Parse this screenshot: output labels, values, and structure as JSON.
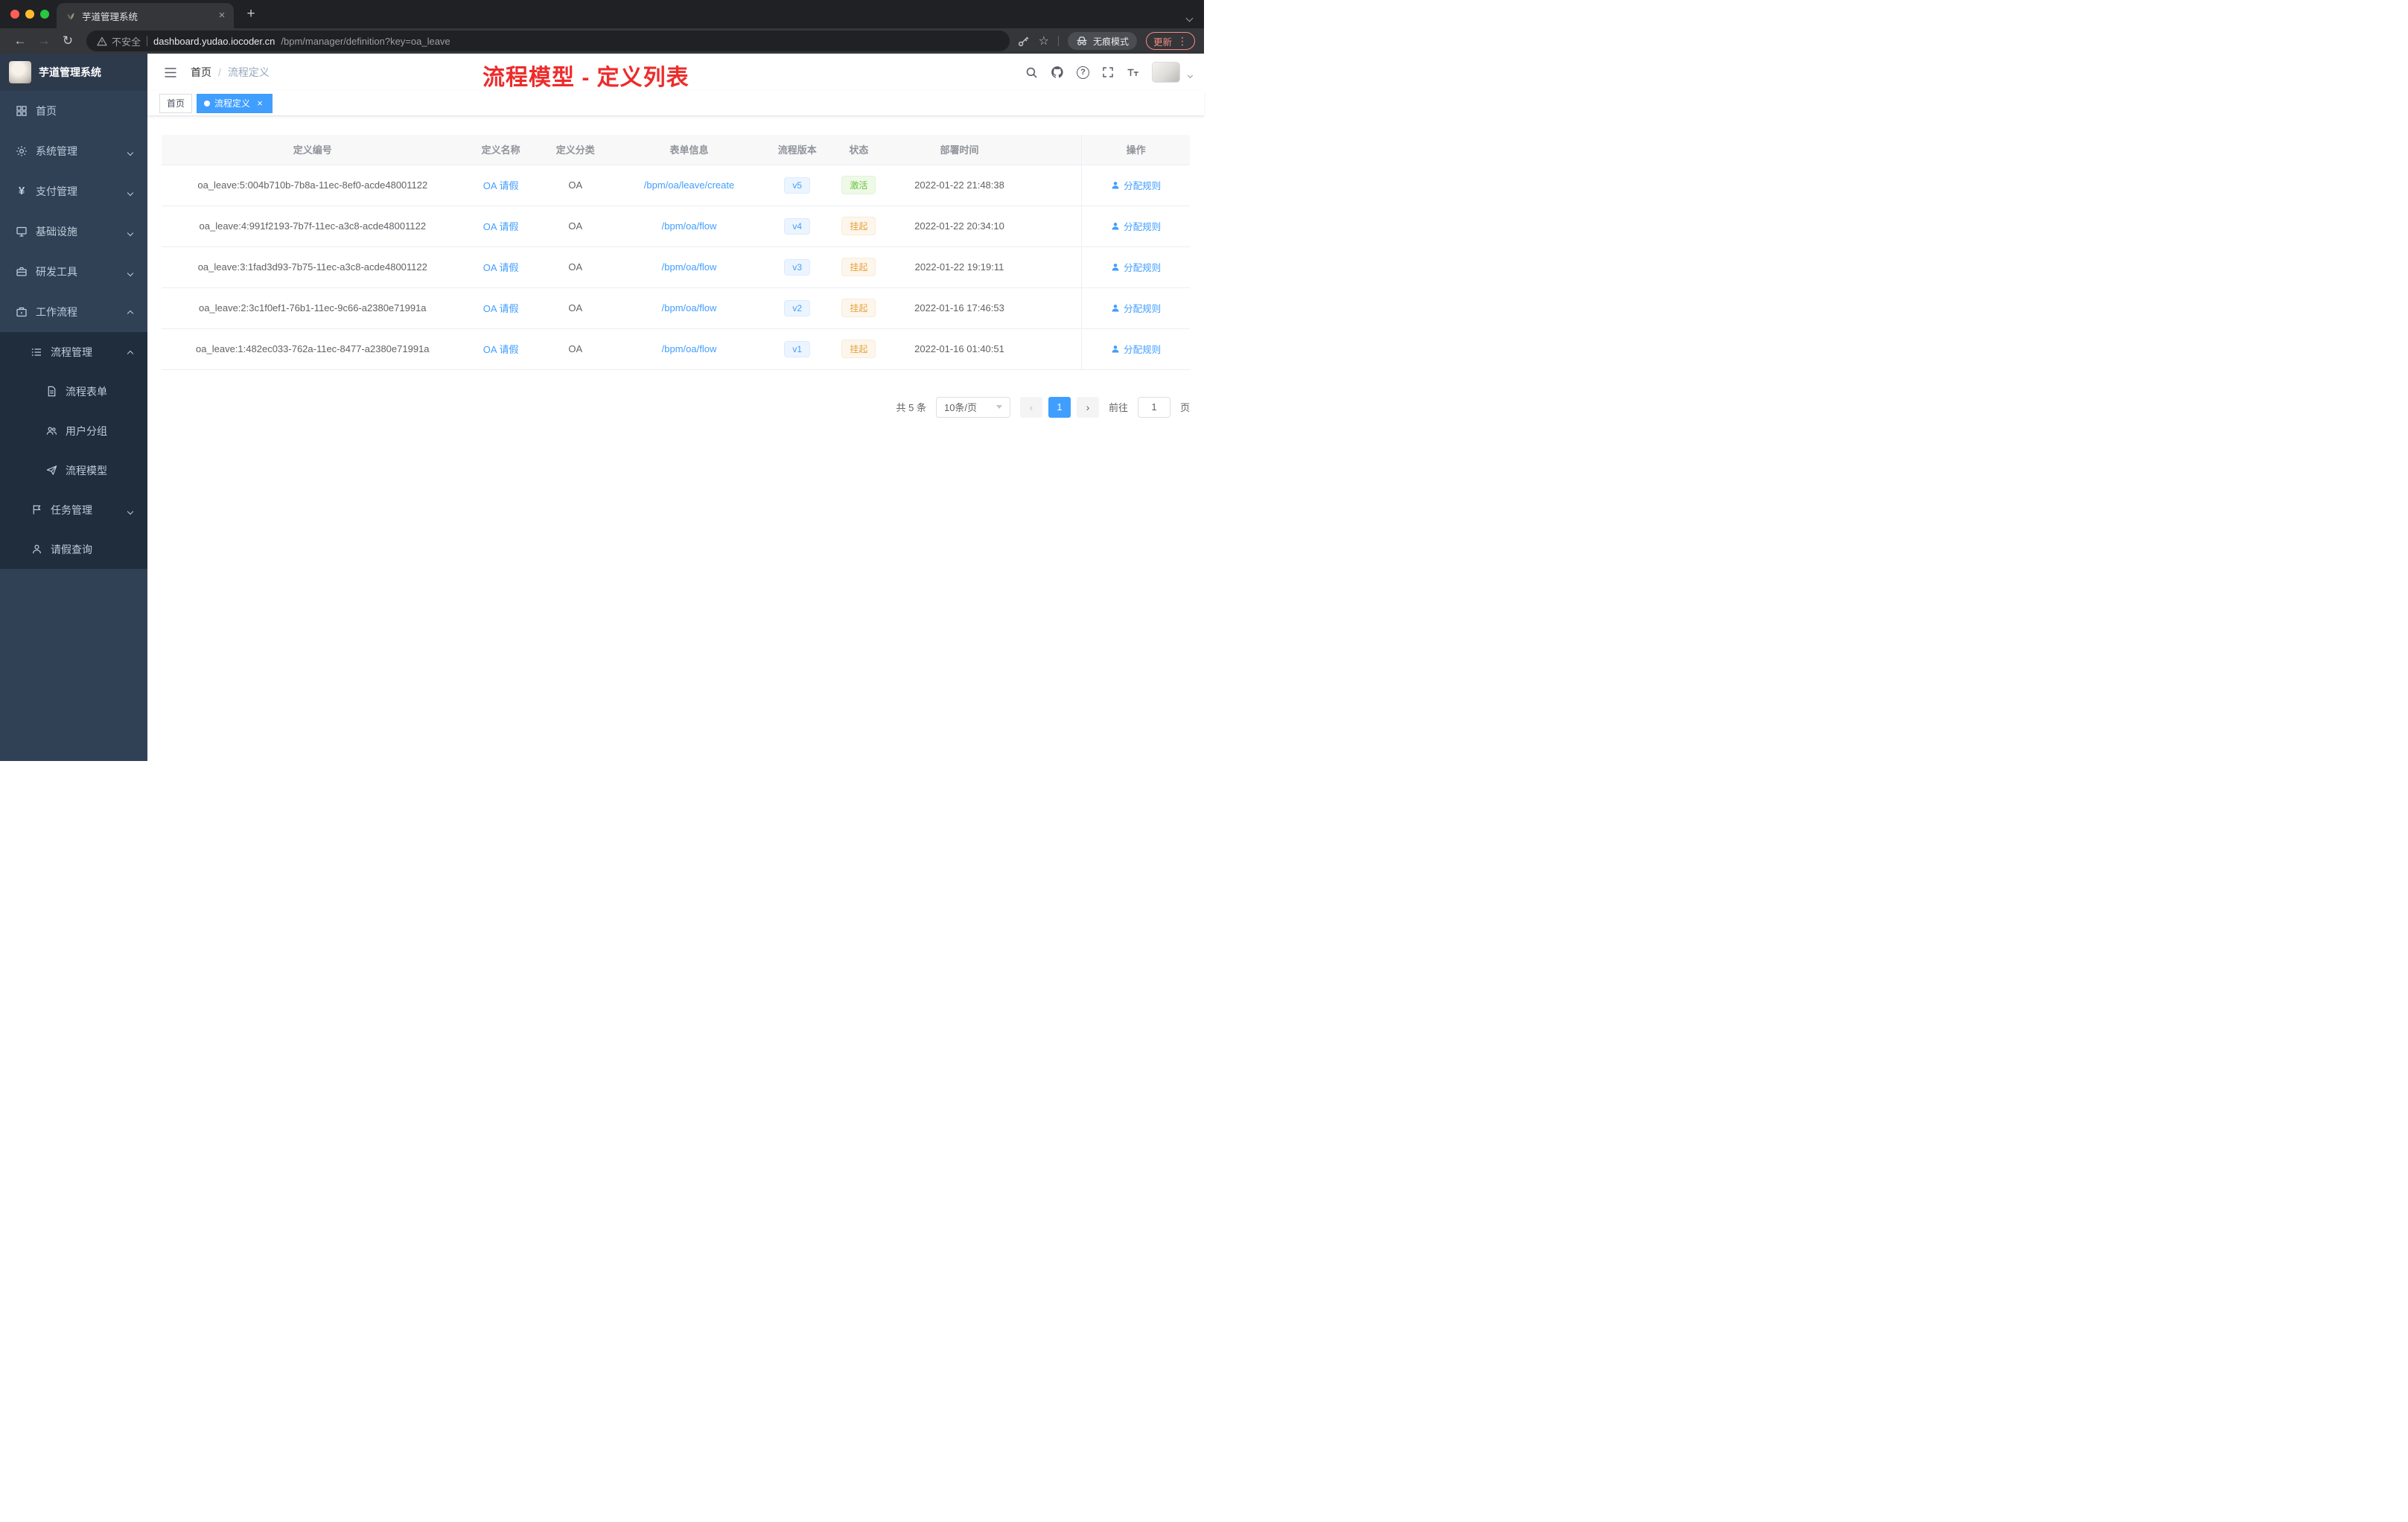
{
  "browser": {
    "tab_title": "芋道管理系统",
    "security_label": "不安全",
    "url_domain": "dashboard.yudao.iocoder.cn",
    "url_path": "/bpm/manager/definition?key=oa_leave",
    "incognito_label": "无痕模式",
    "update_label": "更新"
  },
  "icons": {
    "back": "←",
    "forward": "→",
    "reload": "↻",
    "star": "☆",
    "menu_dots": "⋮",
    "new_tab": "+",
    "close": "×",
    "prev": "‹",
    "next": "›",
    "question": "?",
    "yen": "¥"
  },
  "sidebar": {
    "logo_title": "芋道管理系统",
    "menu": {
      "home": "首页",
      "system": "系统管理",
      "payment": "支付管理",
      "infrastructure": "基础设施",
      "devtools": "研发工具",
      "workflow": "工作流程",
      "process_management": "流程管理",
      "process_form": "流程表单",
      "user_group": "用户分组",
      "process_model": "流程模型",
      "task_management": "任务管理",
      "leave_query": "请假查询"
    }
  },
  "header": {
    "breadcrumb_home": "首页",
    "breadcrumb_separator": "/",
    "breadcrumb_current": "流程定义",
    "annotation": "流程模型 - 定义列表"
  },
  "tags": {
    "home": "首页",
    "current": "流程定义"
  },
  "table": {
    "columns": [
      "定义编号",
      "定义名称",
      "定义分类",
      "表单信息",
      "流程版本",
      "状态",
      "部署时间",
      "操作"
    ],
    "rows": [
      {
        "id": "oa_leave:5:004b710b-7b8a-11ec-8ef0-acde48001122",
        "name": "OA 请假",
        "category": "OA",
        "form": "/bpm/oa/leave/create",
        "version": "v5",
        "status": "激活",
        "status_type": "active",
        "deploy_time": "2022-01-22 21:48:38",
        "action": "分配规则"
      },
      {
        "id": "oa_leave:4:991f2193-7b7f-11ec-a3c8-acde48001122",
        "name": "OA 请假",
        "category": "OA",
        "form": "/bpm/oa/flow",
        "version": "v4",
        "status": "挂起",
        "status_type": "suspended",
        "deploy_time": "2022-01-22 20:34:10",
        "action": "分配规则"
      },
      {
        "id": "oa_leave:3:1fad3d93-7b75-11ec-a3c8-acde48001122",
        "name": "OA 请假",
        "category": "OA",
        "form": "/bpm/oa/flow",
        "version": "v3",
        "status": "挂起",
        "status_type": "suspended",
        "deploy_time": "2022-01-22 19:19:11",
        "action": "分配规则"
      },
      {
        "id": "oa_leave:2:3c1f0ef1-76b1-11ec-9c66-a2380e71991a",
        "name": "OA 请假",
        "category": "OA",
        "form": "/bpm/oa/flow",
        "version": "v2",
        "status": "挂起",
        "status_type": "suspended",
        "deploy_time": "2022-01-16 17:46:53",
        "action": "分配规则"
      },
      {
        "id": "oa_leave:1:482ec033-762a-11ec-8477-a2380e71991a",
        "name": "OA 请假",
        "category": "OA",
        "form": "/bpm/oa/flow",
        "version": "v1",
        "status": "挂起",
        "status_type": "suspended",
        "deploy_time": "2022-01-16 01:40:51",
        "action": "分配规则"
      }
    ]
  },
  "pagination": {
    "total": "共 5 条",
    "page_size": "10条/页",
    "current_page": "1",
    "goto_label": "前往",
    "goto_value": "1",
    "goto_unit": "页"
  },
  "colors": {
    "primary": "#409eff",
    "status_active": "#67c23a",
    "status_suspended": "#e6a23c",
    "annotation_red": "#ee2b2b",
    "sidebar_bg": "#304156",
    "submenu_bg": "#1f2d3d"
  }
}
